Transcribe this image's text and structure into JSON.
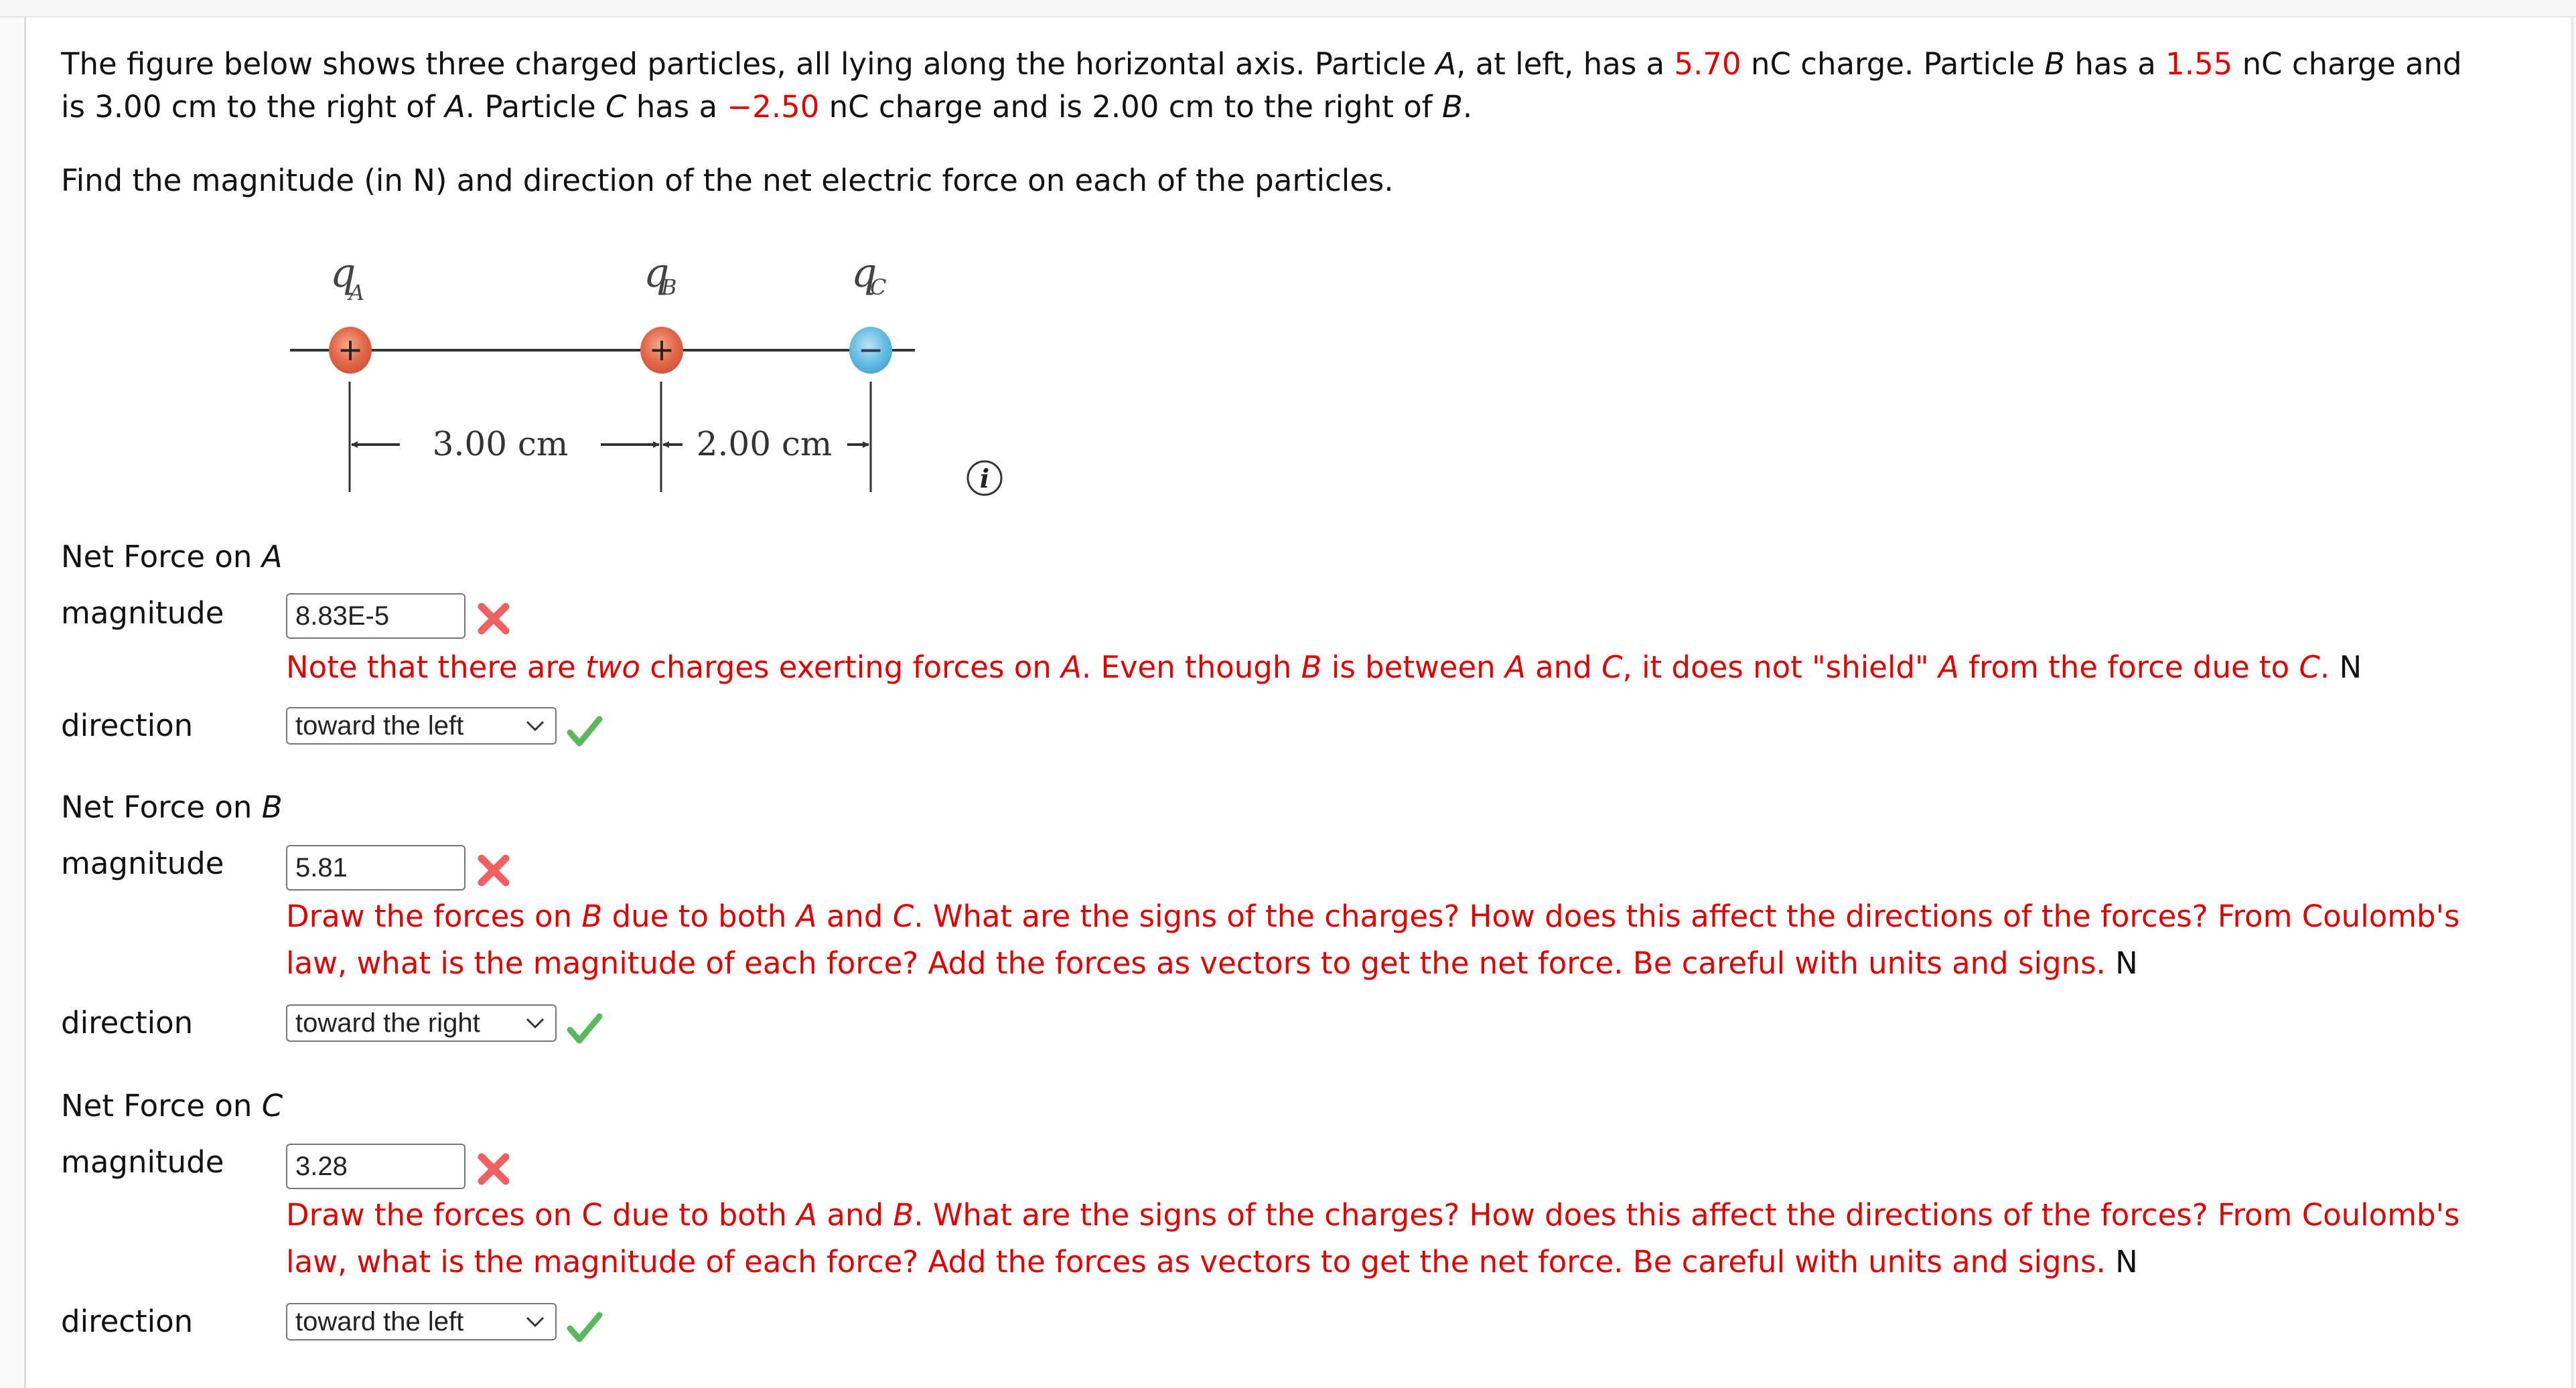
{
  "problem": {
    "line1": {
      "t1": "The figure below shows three charged particles, all lying along the horizontal axis. Particle ",
      "A": "A",
      "t2": ", at left, has a ",
      "qA": "5.70",
      "t3": " nC charge. Particle ",
      "B": "B",
      "t4": " has a ",
      "qB": "1.55",
      "t5": " nC charge and"
    },
    "line2": {
      "t1": "is 3.00 cm to the right of ",
      "A": "A",
      "t2": ". Particle ",
      "C": "C",
      "t3": " has a ",
      "qC": "−2.50",
      "t4": " nC charge and is 2.00 cm to the right of ",
      "B": "B",
      "t5": "."
    },
    "instruction": "Find the magnitude (in N) and direction of the net electric force on each of the particles."
  },
  "figure": {
    "labels": {
      "qA_main": "q",
      "qA_sub": "A",
      "qB_main": "q",
      "qB_sub": "B",
      "qC_main": "q",
      "qC_sub": "C"
    },
    "signs": {
      "A": "+",
      "B": "+",
      "C": "−"
    },
    "dist_AB": "3.00 cm",
    "dist_BC": "2.00 cm",
    "colors": {
      "positive": "#e46a4c",
      "negative": "#6cc0e4"
    },
    "info_icon": "i"
  },
  "questions": [
    {
      "title_prefix": "Net Force on ",
      "title_var": "A",
      "magnitude_label": "magnitude",
      "magnitude_value": "8.83E-5",
      "magnitude_status": "incorrect",
      "feedback": {
        "p1": "Note that there are ",
        "em1": "two",
        "p2": " charges exerting forces on ",
        "v1": "A",
        "p3": ". Even though ",
        "v2": "B",
        "p4": " is between ",
        "v3": "A",
        "p5": " and ",
        "v4": "C",
        "p6": ", it does not \"shield\" ",
        "v5": "A",
        "p7": " from the force due to ",
        "v6": "C",
        "p8": ".",
        "unit": "N"
      },
      "direction_label": "direction",
      "direction_value": "toward the left",
      "direction_status": "correct"
    },
    {
      "title_prefix": "Net Force on ",
      "title_var": "B",
      "magnitude_label": "magnitude",
      "magnitude_value": "5.81",
      "magnitude_status": "incorrect",
      "feedback": {
        "p1": "Draw the forces on ",
        "v1": "B",
        "p2": " due to both ",
        "v2": "A",
        "p3": " and ",
        "v3": "C",
        "p4": ". What are the signs of the charges? How does this affect the directions of the forces? From Coulomb's",
        "line2": "law, what is the magnitude of each force? Add the forces as vectors to get the net force. Be careful with units and signs.",
        "unit": "N"
      },
      "direction_label": "direction",
      "direction_value": "toward the right",
      "direction_status": "correct"
    },
    {
      "title_prefix": "Net Force on ",
      "title_var": "C",
      "magnitude_label": "magnitude",
      "magnitude_value": "3.28",
      "magnitude_status": "incorrect",
      "feedback": {
        "p1": "Draw the forces on C due to both ",
        "v1": "A",
        "p2": " and ",
        "v2": "B",
        "p3": ". What are the signs of the charges? How does this affect the directions of the forces? From Coulomb's",
        "line2": "law, what is the magnitude of each force? Add the forces as vectors to get the net force. Be careful with units and signs.",
        "unit": "N"
      },
      "direction_label": "direction",
      "direction_value": "toward the left",
      "direction_status": "correct"
    }
  ],
  "icons": {
    "incorrect": "x-mark-icon",
    "correct": "check-mark-icon",
    "info": "info-icon",
    "dropdown": "chevron-down-icon"
  },
  "colors": {
    "feedback_red": "#e00000",
    "incorrect_x": "#f06060",
    "correct_check": "#5cb85c"
  }
}
